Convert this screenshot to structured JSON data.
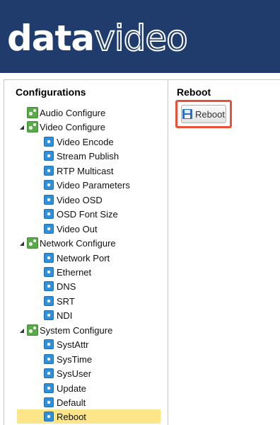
{
  "brand": {
    "logo_bold": "data",
    "logo_light": "video"
  },
  "left_panel": {
    "title": "Configurations",
    "tree": [
      {
        "label": "Audio Configure",
        "level": 0,
        "icon": "gear-group-icon",
        "toggle": ""
      },
      {
        "label": "Video Configure",
        "level": 0,
        "icon": "gear-group-icon",
        "toggle": "expanded"
      },
      {
        "label": "Video Encode",
        "level": 1,
        "icon": "gear-item-icon"
      },
      {
        "label": "Stream Publish",
        "level": 1,
        "icon": "gear-item-icon"
      },
      {
        "label": "RTP Multicast",
        "level": 1,
        "icon": "gear-item-icon"
      },
      {
        "label": "Video Parameters",
        "level": 1,
        "icon": "gear-item-icon"
      },
      {
        "label": "Video OSD",
        "level": 1,
        "icon": "gear-item-icon"
      },
      {
        "label": "OSD Font Size",
        "level": 1,
        "icon": "gear-item-icon"
      },
      {
        "label": "Video Out",
        "level": 1,
        "icon": "gear-item-icon"
      },
      {
        "label": "Network Configure",
        "level": 0,
        "icon": "gear-group-icon",
        "toggle": "expanded"
      },
      {
        "label": "Network Port",
        "level": 1,
        "icon": "gear-item-icon"
      },
      {
        "label": "Ethernet",
        "level": 1,
        "icon": "gear-item-icon"
      },
      {
        "label": "DNS",
        "level": 1,
        "icon": "gear-item-icon"
      },
      {
        "label": "SRT",
        "level": 1,
        "icon": "gear-item-icon"
      },
      {
        "label": "NDI",
        "level": 1,
        "icon": "gear-item-icon"
      },
      {
        "label": "System Configure",
        "level": 0,
        "icon": "gear-group-icon",
        "toggle": "expanded"
      },
      {
        "label": "SystAttr",
        "level": 1,
        "icon": "gear-item-icon"
      },
      {
        "label": "SysTime",
        "level": 1,
        "icon": "gear-item-icon"
      },
      {
        "label": "SysUser",
        "level": 1,
        "icon": "gear-item-icon"
      },
      {
        "label": "Update",
        "level": 1,
        "icon": "gear-item-icon"
      },
      {
        "label": "Default",
        "level": 1,
        "icon": "gear-item-icon"
      },
      {
        "label": "Reboot",
        "level": 1,
        "icon": "gear-item-icon",
        "selected": true
      }
    ]
  },
  "right_panel": {
    "title": "Reboot",
    "button_label": "Reboot",
    "button_icon": "floppy-disk-icon"
  },
  "colors": {
    "header_bg": "#1f3c6d",
    "selected_bg": "#fde68a",
    "highlight_border": "#e5533a",
    "group_icon": "#5aa94a",
    "item_icon": "#2f8fd8"
  }
}
